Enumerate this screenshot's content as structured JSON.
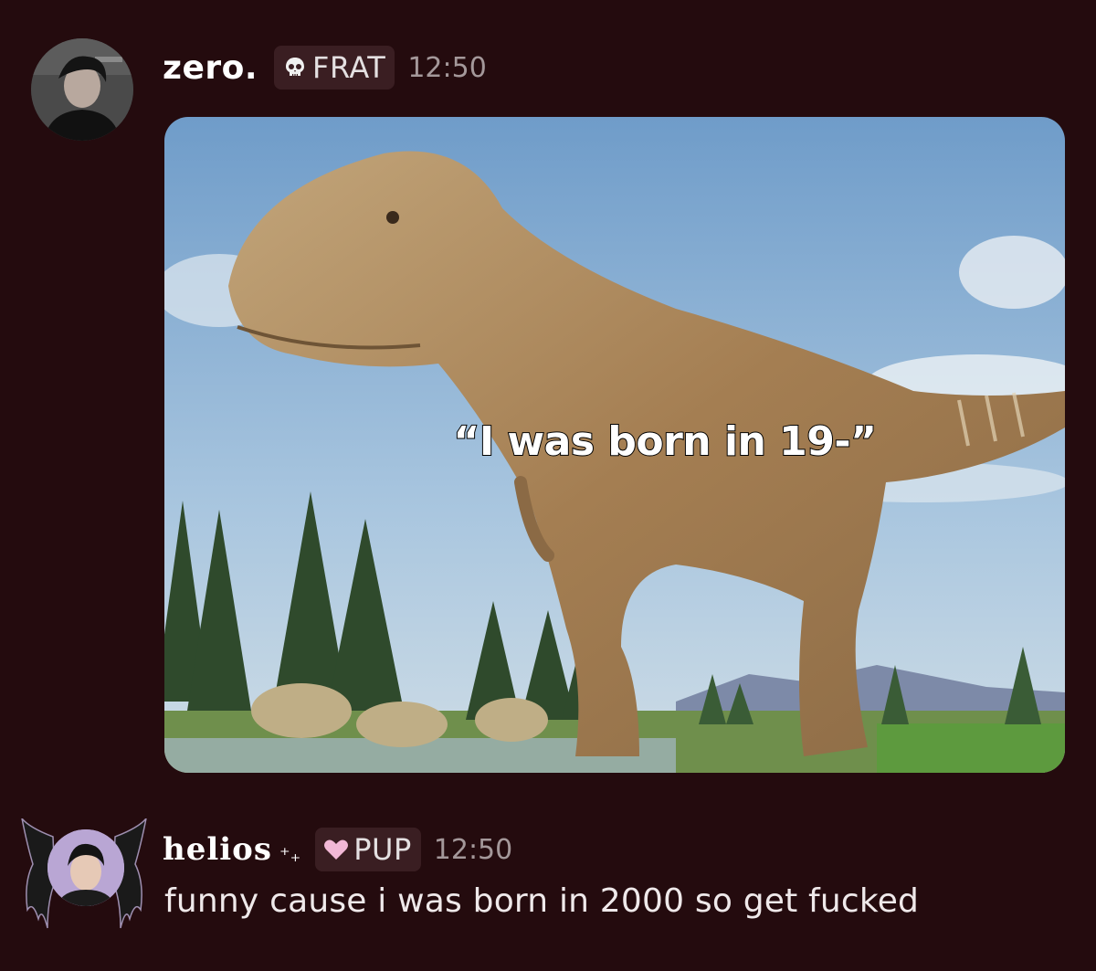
{
  "messages": [
    {
      "username": "zero.",
      "tag": {
        "icon": "skull-icon",
        "label": "FRAT"
      },
      "time": "12:50",
      "attachment": {
        "caption": "“I was born in 19-”"
      }
    },
    {
      "username": "helios",
      "username_decoration": "⁺₊",
      "tag": {
        "icon": "heart-icon",
        "label": "PUP"
      },
      "time": "12:50",
      "text": "funny cause i was born in 2000 so get fucked"
    }
  ],
  "colors": {
    "background": "#240b0e",
    "tag_background": "#3a1e22",
    "timestamp": "#a4989a",
    "heart": "#f2b8d6"
  }
}
